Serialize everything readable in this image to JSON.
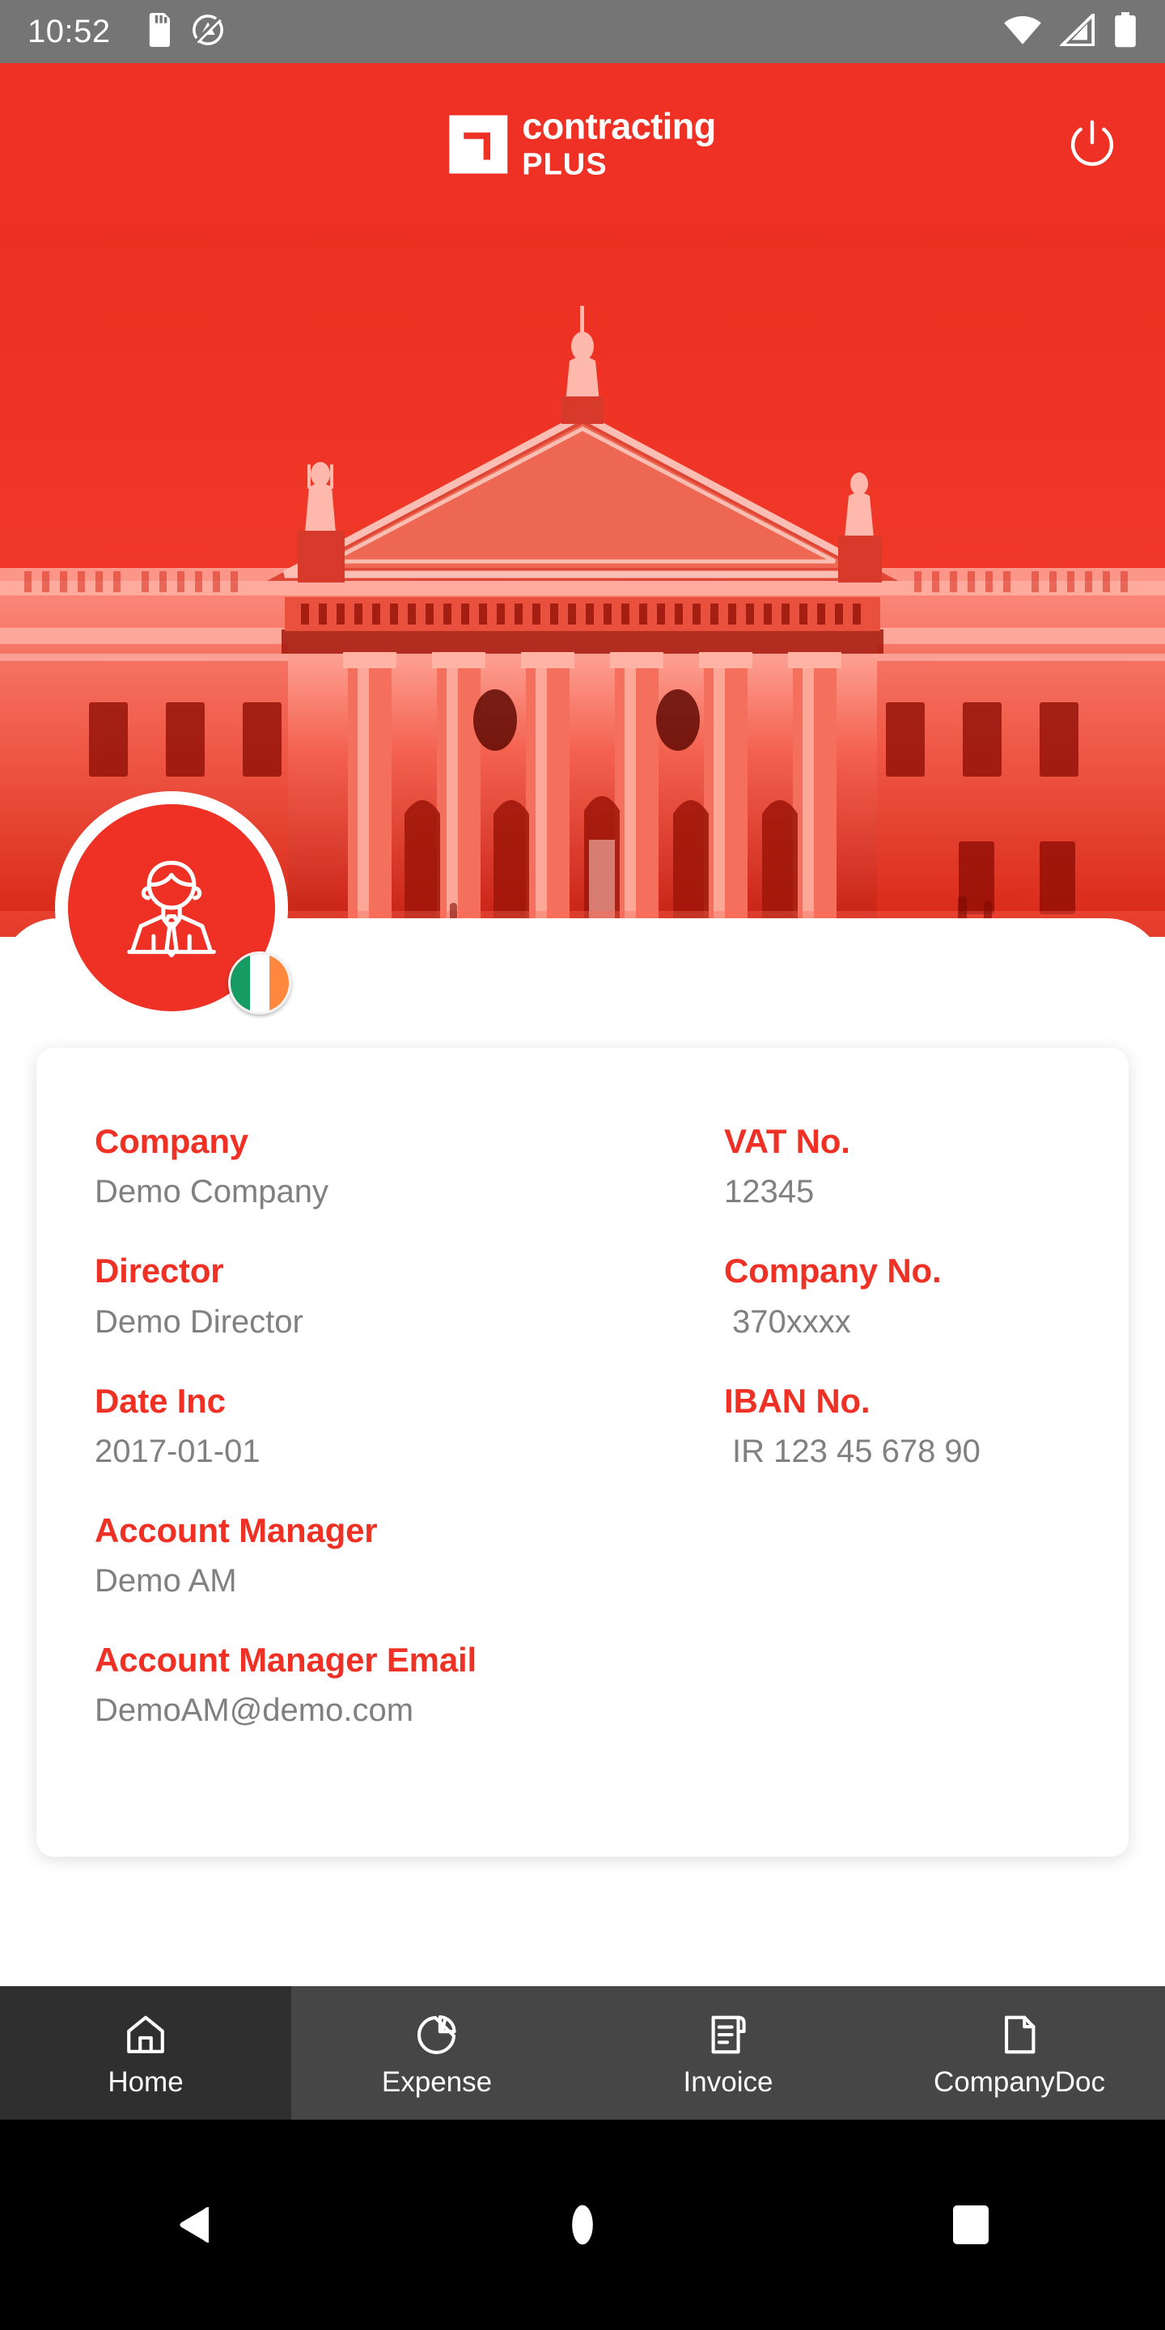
{
  "status_bar": {
    "time": "10:52",
    "icons": [
      "sd-card-icon",
      "do-not-disturb-icon",
      "wifi-icon",
      "cellular-signal-icon",
      "battery-icon"
    ]
  },
  "header": {
    "logo_line1": "contracting",
    "logo_line2": "PLUS",
    "logo_mark": "contracting-plus-arrow-mark",
    "power_icon": "power-icon"
  },
  "hero": {
    "image_alt": "red-tinted-neoclassical-building"
  },
  "profile": {
    "avatar_icon": "businessman-avatar-icon",
    "flag": "ireland-flag-badge",
    "flag_colors": [
      "#169b62",
      "#ffffff",
      "#ff883e"
    ]
  },
  "info_card": {
    "left_fields": [
      {
        "label": "Company",
        "value": "Demo Company"
      },
      {
        "label": "Director",
        "value": "Demo Director"
      },
      {
        "label": "Date Inc",
        "value": "2017-01-01"
      },
      {
        "label": "Account Manager",
        "value": "Demo AM"
      },
      {
        "label": "Account Manager Email",
        "value": "DemoAM@demo.com"
      }
    ],
    "right_fields": [
      {
        "label": "VAT No.",
        "value": "12345"
      },
      {
        "label": "Company No.",
        "value": "370xxxx"
      },
      {
        "label": "IBAN No.",
        "value": "IR 123 45 678 90"
      }
    ]
  },
  "bottom_nav": {
    "items": [
      {
        "label": "Home",
        "icon": "home-icon",
        "active": true
      },
      {
        "label": "Expense",
        "icon": "pie-chart-icon",
        "active": false
      },
      {
        "label": "Invoice",
        "icon": "invoice-document-icon",
        "active": false
      },
      {
        "label": "CompanyDoc",
        "icon": "file-page-icon",
        "active": false
      }
    ]
  },
  "system_nav": {
    "back": "back-triangle-icon",
    "home": "home-circle-icon",
    "recents": "recents-square-icon"
  },
  "colors": {
    "brand_red": "#ee3124",
    "status_gray": "#757575",
    "value_gray": "#808080",
    "nav_bg": "#464646",
    "nav_active_bg": "#2f2f2f"
  }
}
